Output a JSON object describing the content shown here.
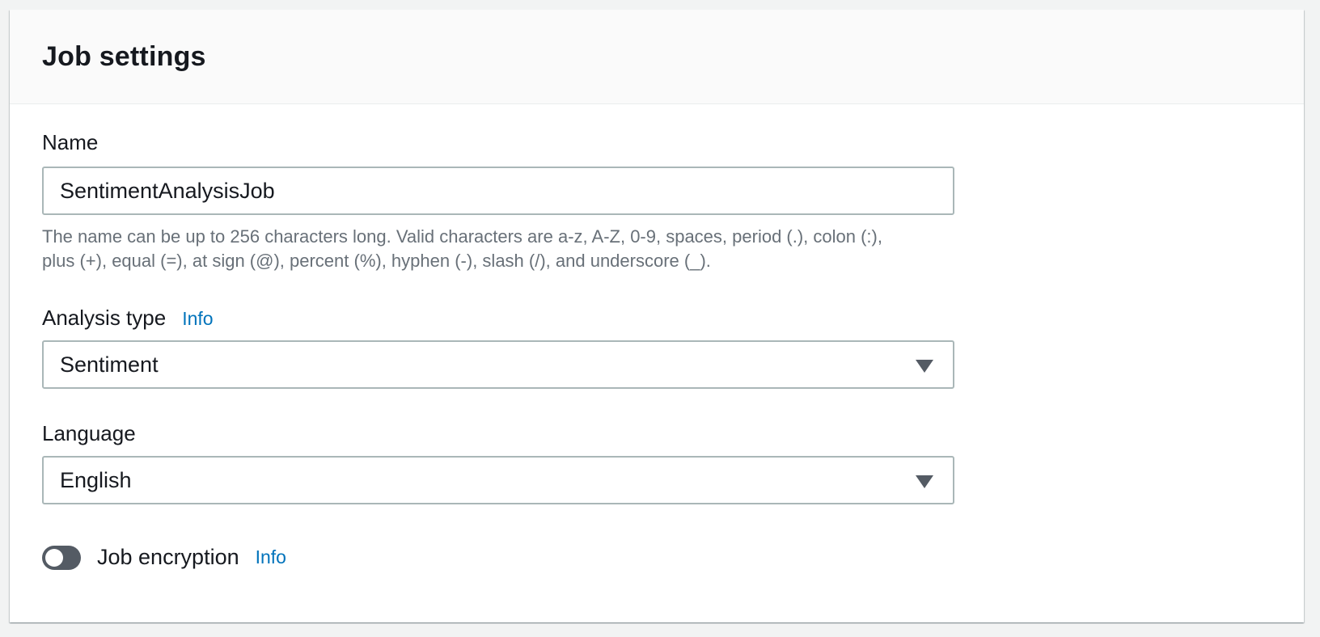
{
  "panel": {
    "title": "Job settings"
  },
  "name_field": {
    "label": "Name",
    "value": "SentimentAnalysisJob",
    "constraint_line1": "The name can be up to 256 characters long. Valid characters are a-z, A-Z, 0-9, spaces, period (.), colon (:),",
    "constraint_line2": "plus (+), equal (=), at sign (@), percent (%), hyphen (-), slash (/), and underscore (_)."
  },
  "analysis_type": {
    "label": "Analysis type",
    "info_label": "Info",
    "selected": "Sentiment",
    "icon": "caret-down-icon"
  },
  "language": {
    "label": "Language",
    "selected": "English",
    "icon": "caret-down-icon"
  },
  "job_encryption": {
    "label": "Job encryption",
    "info_label": "Info",
    "enabled": false
  },
  "colors": {
    "link": "#0073bb",
    "border": "#aab7b8",
    "toggle_off": "#545b64",
    "header_bg": "#fafafa"
  }
}
